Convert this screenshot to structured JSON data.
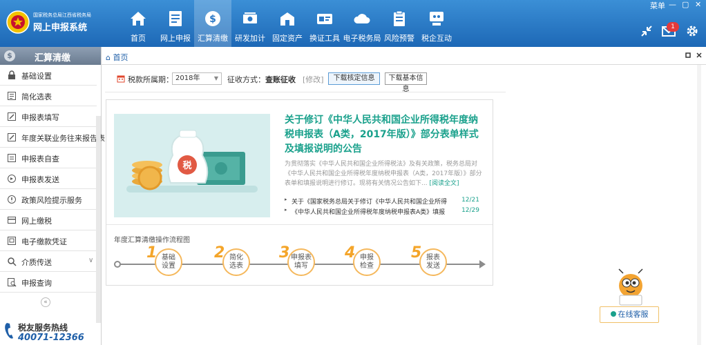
{
  "app": {
    "org_name": "国家税务总局江西省税务局",
    "title": "网上申报系统",
    "window_menu": "菜单",
    "win_min": "—",
    "win_max": "▢",
    "win_close": "✕"
  },
  "nav": [
    {
      "label": "首页",
      "icon": "home-icon"
    },
    {
      "label": "网上申报",
      "icon": "document-icon"
    },
    {
      "label": "汇算清缴",
      "icon": "dollar-icon"
    },
    {
      "label": "研发加计",
      "icon": "money-icon"
    },
    {
      "label": "固定资产",
      "icon": "building-icon"
    },
    {
      "label": "换证工具",
      "icon": "card-icon"
    },
    {
      "label": "电子税务局",
      "icon": "cloud-icon"
    },
    {
      "label": "风险预警",
      "icon": "clipboard-icon"
    },
    {
      "label": "税企互动",
      "icon": "interaction-icon"
    }
  ],
  "header_right": {
    "message_count": "1"
  },
  "sidebar": {
    "title": "汇算清缴",
    "coin_symbol": "$",
    "items": [
      {
        "label": "基础设置",
        "icon": "lock-icon"
      },
      {
        "label": "简化选表",
        "icon": "list-icon"
      },
      {
        "label": "申报表填写",
        "icon": "edit-icon"
      },
      {
        "label": "年度关联业务往来报告表",
        "icon": "edit-icon"
      },
      {
        "label": "申报表自查",
        "icon": "check-icon"
      },
      {
        "label": "申报表发送",
        "icon": "send-icon"
      },
      {
        "label": "政策风险提示服务",
        "icon": "shield-icon"
      },
      {
        "label": "网上缴税",
        "icon": "pay-icon"
      },
      {
        "label": "电子缴款凭证",
        "icon": "receipt-icon"
      },
      {
        "label": "介质传送",
        "icon": "search-icon"
      },
      {
        "label": "申报查询",
        "icon": "query-icon"
      }
    ],
    "collapse_symbol": "«",
    "hotline_label": "税友服务热线",
    "hotline_number": "40071-12366"
  },
  "tabs": {
    "home": "首页"
  },
  "toolbar": {
    "period_label": "税款所属期：",
    "period_value": "2018年",
    "collect_label": "征收方式：",
    "collect_value": "查账征收",
    "modify_link": "[修改]",
    "btn_download_verify": "下载核定信息",
    "btn_download_basic": "下载基本信息"
  },
  "news": {
    "title": "关于修订《中华人民共和国企业所得税年度纳税申报表（A类，2017年版）》部分表单样式及填报说明的公告",
    "desc": "为贯彻落实《中华人民共和国企业所得税法》及有关政策，税务总局对《中华人民共和国企业所得税年度纳税申报表（A类，2017年版）》部分表单和填报说明进行修订。现将有关情况公告如下...",
    "read_more": "[阅读全文]",
    "items": [
      {
        "text": "关于《国家税务总局关于修订《中华人民共和国企业所得",
        "date": "12/21"
      },
      {
        "text": "《中华人民共和国企业所得税年度纳税申报表A类》填报",
        "date": "12/29"
      }
    ],
    "image_badge": "税"
  },
  "flow": {
    "title": "年度汇算清缴操作流程图",
    "steps": [
      {
        "num": "1",
        "line1": "基础",
        "line2": "设置"
      },
      {
        "num": "2",
        "line1": "简化",
        "line2": "选表"
      },
      {
        "num": "3",
        "line1": "申报表",
        "line2": "填写"
      },
      {
        "num": "4",
        "line1": "申报",
        "line2": "检查"
      },
      {
        "num": "5",
        "line1": "报表",
        "line2": "发送"
      }
    ]
  },
  "service": {
    "label": "在线客服"
  }
}
